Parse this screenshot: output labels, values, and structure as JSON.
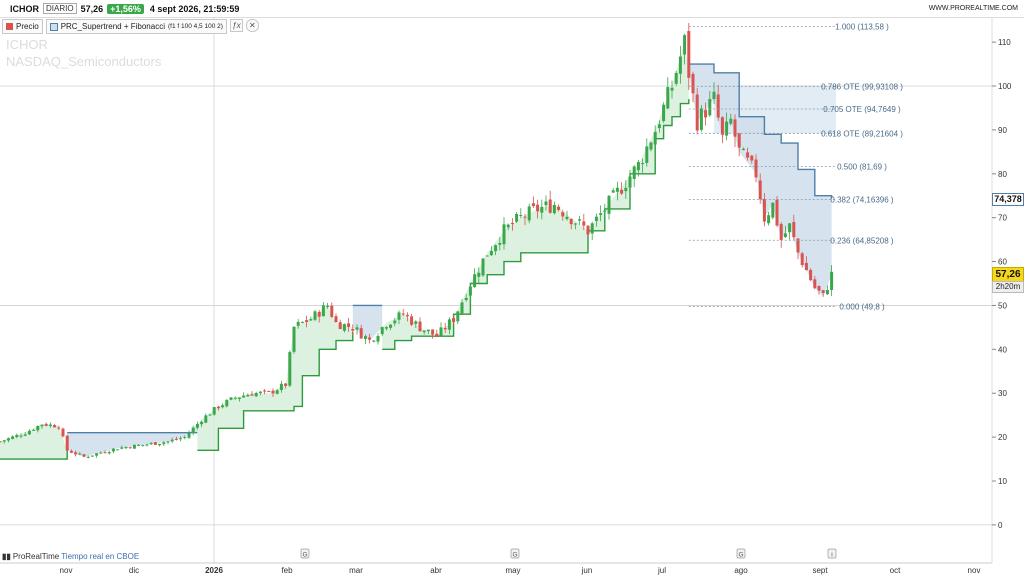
{
  "header": {
    "ticker": "ICHOR",
    "period": "DIARIO",
    "price": "57,26",
    "change": "+1,56%",
    "datetime": "4 sept 2026, 21:59:59",
    "website": "WWW.PROREALTIME.COM"
  },
  "legend": {
    "price_label": "Precio",
    "indicator_name": "PRC_Supertrend + Fibonacci",
    "indicator_params": "(f1 f 100 4,5 100 2)",
    "fx_icon": "fx-icon",
    "close_icon": "close-icon"
  },
  "watermark": {
    "line1": "ICHOR",
    "line2": "NASDAQ_Semiconductors"
  },
  "footer": {
    "brand": "ProRealTime",
    "realtime": "Tiempo real en CBOE"
  },
  "price_labels": {
    "supertrend_value": "74,378",
    "last_price": "57,26",
    "countdown": "2h20m",
    "last_price_bg": "#f5d71c",
    "supertrend_bg": "#ffffff"
  },
  "colors": {
    "up": "#3aa84a",
    "down": "#d9534f",
    "uptrend_line": "#2e9a3e",
    "uptrend_fill": "#d6efd9",
    "downtrend_line": "#4f7fa8",
    "downtrend_fill": "#cfdeeb",
    "fib_zone_fill": "#d8e5f0"
  },
  "chart_data": {
    "type": "candlestick",
    "y_axis_side": "right",
    "ylim": [
      -3,
      118
    ],
    "y_ticks": [
      "0",
      "10",
      "20",
      "30",
      "40",
      "50",
      "60",
      "70",
      "80",
      "90",
      "100",
      "110"
    ],
    "x_tick_labels": [
      "nov",
      "dic",
      "2026",
      "feb",
      "mar",
      "abr",
      "may",
      "jun",
      "jul",
      "ago",
      "sept",
      "oct",
      "nov"
    ],
    "fibonacci_levels": [
      {
        "label": "1.000 (113,58 )",
        "value": 113.58
      },
      {
        "label": "0.786 OTE (99,93108 )",
        "value": 99.93
      },
      {
        "label": "0.705 OTE (94,7649 )",
        "value": 94.76
      },
      {
        "label": "0.618 OTE (89,21604 )",
        "value": 89.22
      },
      {
        "label": "0.500 (81,69 )",
        "value": 81.69
      },
      {
        "label": "0.382 (74,16396 )",
        "value": 74.16
      },
      {
        "label": "0.236 (64,85208 )",
        "value": 64.85
      },
      {
        "label": "0.000 (49,8 )",
        "value": 49.8
      }
    ],
    "event_markers": [
      "G",
      "G",
      "G",
      "i"
    ],
    "close_path": [
      [
        0,
        19
      ],
      [
        6,
        21
      ],
      [
        10,
        23
      ],
      [
        14,
        22.5
      ],
      [
        16,
        17
      ],
      [
        20,
        15.5
      ],
      [
        24,
        16.5
      ],
      [
        28,
        17.5
      ],
      [
        32,
        18
      ],
      [
        36,
        18.5
      ],
      [
        40,
        19
      ],
      [
        44,
        20
      ],
      [
        48,
        24
      ],
      [
        52,
        27
      ],
      [
        56,
        29
      ],
      [
        60,
        30
      ],
      [
        64,
        30
      ],
      [
        68,
        32
      ],
      [
        70,
        45
      ],
      [
        74,
        47
      ],
      [
        78,
        50
      ],
      [
        80,
        46
      ],
      [
        84,
        45
      ],
      [
        88,
        42
      ],
      [
        92,
        46
      ],
      [
        96,
        48
      ],
      [
        100,
        45
      ],
      [
        104,
        43
      ],
      [
        108,
        47
      ],
      [
        112,
        55
      ],
      [
        116,
        62
      ],
      [
        120,
        67
      ],
      [
        124,
        70
      ],
      [
        128,
        72
      ],
      [
        132,
        73
      ],
      [
        136,
        70
      ],
      [
        140,
        67
      ],
      [
        144,
        72
      ],
      [
        148,
        77
      ],
      [
        152,
        82
      ],
      [
        156,
        90
      ],
      [
        160,
        100
      ],
      [
        163,
        110
      ],
      [
        164,
        103
      ],
      [
        166,
        92
      ],
      [
        170,
        97
      ],
      [
        172,
        88
      ],
      [
        174,
        92
      ],
      [
        176,
        85
      ],
      [
        180,
        80
      ],
      [
        182,
        70
      ],
      [
        184,
        73
      ],
      [
        186,
        65
      ],
      [
        188,
        68
      ],
      [
        190,
        62
      ],
      [
        192,
        58
      ],
      [
        194,
        54
      ],
      [
        196,
        52
      ],
      [
        198,
        57
      ]
    ],
    "supertrend": [
      {
        "trend": "up",
        "points": [
          [
            0,
            15
          ],
          [
            15,
            15
          ],
          [
            16,
            17.5
          ]
        ]
      },
      {
        "trend": "down",
        "points": [
          [
            16,
            21
          ],
          [
            47,
            21
          ]
        ]
      },
      {
        "trend": "up",
        "points": [
          [
            47,
            17
          ],
          [
            52,
            22
          ],
          [
            58,
            26
          ],
          [
            70,
            27
          ],
          [
            72,
            34
          ],
          [
            76,
            40
          ],
          [
            80,
            42
          ],
          [
            84,
            44
          ]
        ]
      },
      {
        "trend": "down",
        "points": [
          [
            84,
            50
          ],
          [
            91,
            50
          ]
        ]
      },
      {
        "trend": "up",
        "points": [
          [
            91,
            40
          ],
          [
            94,
            42
          ],
          [
            98,
            43
          ],
          [
            104,
            43
          ],
          [
            108,
            48
          ],
          [
            112,
            55
          ],
          [
            116,
            57
          ],
          [
            120,
            60
          ],
          [
            124,
            62
          ],
          [
            136,
            62
          ],
          [
            140,
            67
          ],
          [
            144,
            72
          ],
          [
            150,
            80
          ],
          [
            156,
            88
          ],
          [
            158,
            91
          ],
          [
            160,
            93
          ],
          [
            162,
            96
          ],
          [
            164,
            97
          ]
        ]
      },
      {
        "trend": "down",
        "points": [
          [
            164,
            105
          ],
          [
            170,
            103
          ],
          [
            176,
            93
          ],
          [
            182,
            89
          ],
          [
            186,
            87
          ],
          [
            190,
            81
          ],
          [
            194,
            75
          ],
          [
            198,
            74.4
          ]
        ]
      }
    ]
  }
}
